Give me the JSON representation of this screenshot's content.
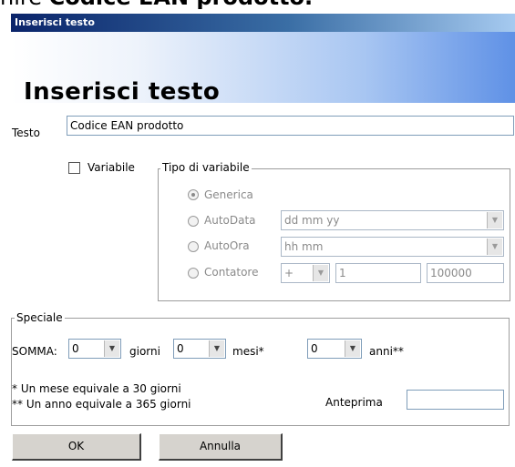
{
  "context_text": {
    "prefix": "nire ",
    "bold": "Codice EAN prodotto",
    "suffix": "."
  },
  "window": {
    "title": "Inserisci testo",
    "heading": "Inserisci testo"
  },
  "testo": {
    "label": "Testo",
    "value": "Codice EAN prodotto"
  },
  "variabile": {
    "label": "Variabile",
    "checked": false
  },
  "tipo_variabile": {
    "legend": "Tipo di variabile",
    "options": [
      {
        "label": "Generica",
        "selected": true
      },
      {
        "label": "AutoData",
        "selected": false,
        "field": "dd mm yy"
      },
      {
        "label": "AutoOra",
        "selected": false,
        "field": "hh mm"
      },
      {
        "label": "Contatore",
        "selected": false,
        "operator": "+",
        "start": "1",
        "end": "100000"
      }
    ]
  },
  "speciale": {
    "legend": "Speciale",
    "somma_label": "SOMMA:",
    "giorni": {
      "value": "0",
      "unit": "giorni"
    },
    "mesi": {
      "value": "0",
      "unit": "mesi*"
    },
    "anni": {
      "value": "0",
      "unit": "anni**"
    },
    "note1": "* Un mese equivale a 30 giorni",
    "note2": "** Un anno equivale a 365 giorni",
    "anteprima_label": "Anteprima",
    "anteprima_value": ""
  },
  "buttons": {
    "ok": "OK",
    "annulla": "Annulla"
  },
  "icons": {
    "dropdown": "chevron-down-icon"
  },
  "colors": {
    "titlebar_start": "#0a246a",
    "banner_end": "#5f91e6",
    "button_face": "#d6d3ce",
    "disabled_text": "#8a8a8a"
  }
}
